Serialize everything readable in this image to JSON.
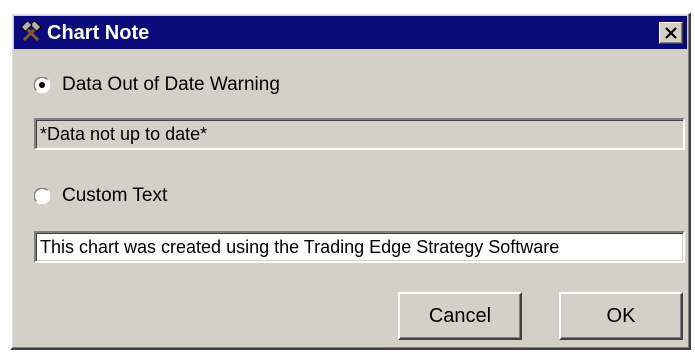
{
  "window": {
    "title": "Chart Note",
    "title_bar_color": "#0a0a7a",
    "face_color": "#d4d0c8",
    "app_icon": "crossed-hammers-icon",
    "close_icon": "close-icon"
  },
  "options": {
    "warning": {
      "label": "Data Out of Date Warning",
      "selected": true,
      "text_value": "*Data not up to date*"
    },
    "custom": {
      "label": "Custom Text",
      "selected": false,
      "text_value": "This chart was created using the Trading Edge Strategy Software"
    }
  },
  "buttons": {
    "cancel_label": "Cancel",
    "ok_label": "OK"
  }
}
